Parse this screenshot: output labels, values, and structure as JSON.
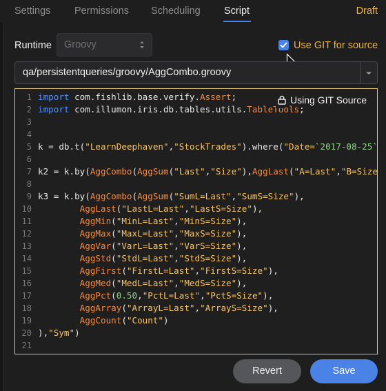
{
  "tabs": [
    {
      "label": "Settings",
      "active": false
    },
    {
      "label": "Permissions",
      "active": false
    },
    {
      "label": "Scheduling",
      "active": false
    },
    {
      "label": "Script",
      "active": true
    }
  ],
  "status": "Draft",
  "runtime": {
    "label": "Runtime",
    "value": "Groovy"
  },
  "git": {
    "checkbox_label": "Use GIT for source",
    "checked": true,
    "badge": "Using GIT Source"
  },
  "path": {
    "value": "qa/persistentqueries/groovy/AggCombo.groovy"
  },
  "editor": {
    "lines": [
      [
        [
          "kw",
          "import"
        ],
        [
          "pl",
          " com.fishlib.base.verify."
        ],
        [
          "fn",
          "Assert"
        ],
        [
          "pl",
          ";"
        ]
      ],
      [
        [
          "kw",
          "import"
        ],
        [
          "pl",
          " com.illumon.iris.db.tables.utils."
        ],
        [
          "fn",
          "TableTools"
        ],
        [
          "pl",
          ";"
        ]
      ],
      [],
      [],
      [
        [
          "pl",
          "k = db.t("
        ],
        [
          "str",
          "\"LearnDeephaven\""
        ],
        [
          "pl",
          ","
        ],
        [
          "str",
          "\"StockTrades\""
        ],
        [
          "pl",
          ").where("
        ],
        [
          "str",
          "\"Date=`"
        ],
        [
          "num",
          "2017-08-25"
        ],
        [
          "str",
          "`\""
        ],
        [
          "pl",
          ")"
        ]
      ],
      [],
      [
        [
          "pl",
          "k2 = k.by("
        ],
        [
          "fn",
          "AggCombo"
        ],
        [
          "pl",
          "("
        ],
        [
          "fn",
          "AggSum"
        ],
        [
          "pl",
          "("
        ],
        [
          "str",
          "\"Last\""
        ],
        [
          "pl",
          ","
        ],
        [
          "str",
          "\"Size\""
        ],
        [
          "pl",
          "),"
        ],
        [
          "fn",
          "AggLast"
        ],
        [
          "pl",
          "("
        ],
        [
          "str",
          "\"A=Last\""
        ],
        [
          "pl",
          ","
        ],
        [
          "str",
          "\"B=Size\""
        ],
        [
          "pl",
          "))"
        ]
      ],
      [],
      [
        [
          "pl",
          "k3 = k.by("
        ],
        [
          "fn",
          "AggCombo"
        ],
        [
          "pl",
          "("
        ],
        [
          "fn",
          "AggSum"
        ],
        [
          "pl",
          "("
        ],
        [
          "str",
          "\"SumL=Last\""
        ],
        [
          "pl",
          ","
        ],
        [
          "str",
          "\"SumS=Size\""
        ],
        [
          "pl",
          "),"
        ]
      ],
      [
        [
          "pl",
          "        "
        ],
        [
          "fn",
          "AggLast"
        ],
        [
          "pl",
          "("
        ],
        [
          "str",
          "\"LastL=Last\""
        ],
        [
          "pl",
          ","
        ],
        [
          "str",
          "\"LastS=Size\""
        ],
        [
          "pl",
          "),"
        ]
      ],
      [
        [
          "pl",
          "        "
        ],
        [
          "fn",
          "AggMin"
        ],
        [
          "pl",
          "("
        ],
        [
          "str",
          "\"MinL=Last\""
        ],
        [
          "pl",
          ","
        ],
        [
          "str",
          "\"MinS=Size\""
        ],
        [
          "pl",
          "),"
        ]
      ],
      [
        [
          "pl",
          "        "
        ],
        [
          "fn",
          "AggMax"
        ],
        [
          "pl",
          "("
        ],
        [
          "str",
          "\"MaxL=Last\""
        ],
        [
          "pl",
          ","
        ],
        [
          "str",
          "\"MaxS=Size\""
        ],
        [
          "pl",
          "),"
        ]
      ],
      [
        [
          "pl",
          "        "
        ],
        [
          "fn",
          "AggVar"
        ],
        [
          "pl",
          "("
        ],
        [
          "str",
          "\"VarL=Last\""
        ],
        [
          "pl",
          ","
        ],
        [
          "str",
          "\"VarS=Size\""
        ],
        [
          "pl",
          "),"
        ]
      ],
      [
        [
          "pl",
          "        "
        ],
        [
          "fn",
          "AggStd"
        ],
        [
          "pl",
          "("
        ],
        [
          "str",
          "\"StdL=Last\""
        ],
        [
          "pl",
          ","
        ],
        [
          "str",
          "\"StdS=Size\""
        ],
        [
          "pl",
          "),"
        ]
      ],
      [
        [
          "pl",
          "        "
        ],
        [
          "fn",
          "AggFirst"
        ],
        [
          "pl",
          "("
        ],
        [
          "str",
          "\"FirstL=Last\""
        ],
        [
          "pl",
          ","
        ],
        [
          "str",
          "\"FirstS=Size\""
        ],
        [
          "pl",
          "),"
        ]
      ],
      [
        [
          "pl",
          "        "
        ],
        [
          "fn",
          "AggMed"
        ],
        [
          "pl",
          "("
        ],
        [
          "str",
          "\"MedL=Last\""
        ],
        [
          "pl",
          ","
        ],
        [
          "str",
          "\"MedS=Size\""
        ],
        [
          "pl",
          "),"
        ]
      ],
      [
        [
          "pl",
          "        "
        ],
        [
          "fn",
          "AggPct"
        ],
        [
          "pl",
          "("
        ],
        [
          "num",
          "0.50"
        ],
        [
          "pl",
          ","
        ],
        [
          "str",
          "\"PctL=Last\""
        ],
        [
          "pl",
          ","
        ],
        [
          "str",
          "\"PctS=Size\""
        ],
        [
          "pl",
          "),"
        ]
      ],
      [
        [
          "pl",
          "        "
        ],
        [
          "fn",
          "AggArray"
        ],
        [
          "pl",
          "("
        ],
        [
          "str",
          "\"ArrayL=Last\""
        ],
        [
          "pl",
          ","
        ],
        [
          "str",
          "\"ArrayS=Size\""
        ],
        [
          "pl",
          "),"
        ]
      ],
      [
        [
          "pl",
          "        "
        ],
        [
          "fn",
          "AggCount"
        ],
        [
          "pl",
          "("
        ],
        [
          "str",
          "\"Count\""
        ],
        [
          "pl",
          ")"
        ]
      ],
      [
        [
          "pl",
          "),"
        ],
        [
          "str",
          "\"Sym\""
        ],
        [
          "pl",
          ")"
        ]
      ],
      []
    ]
  },
  "buttons": {
    "revert": "Revert",
    "save": "Save"
  },
  "colors": {
    "accent": "#4a82e6",
    "draft": "#f1b441",
    "keyword": "#4f93ff",
    "function": "#f08d49",
    "string": "#f5c46c",
    "number": "#8fd18c",
    "focus_border": "#e3c47d"
  }
}
